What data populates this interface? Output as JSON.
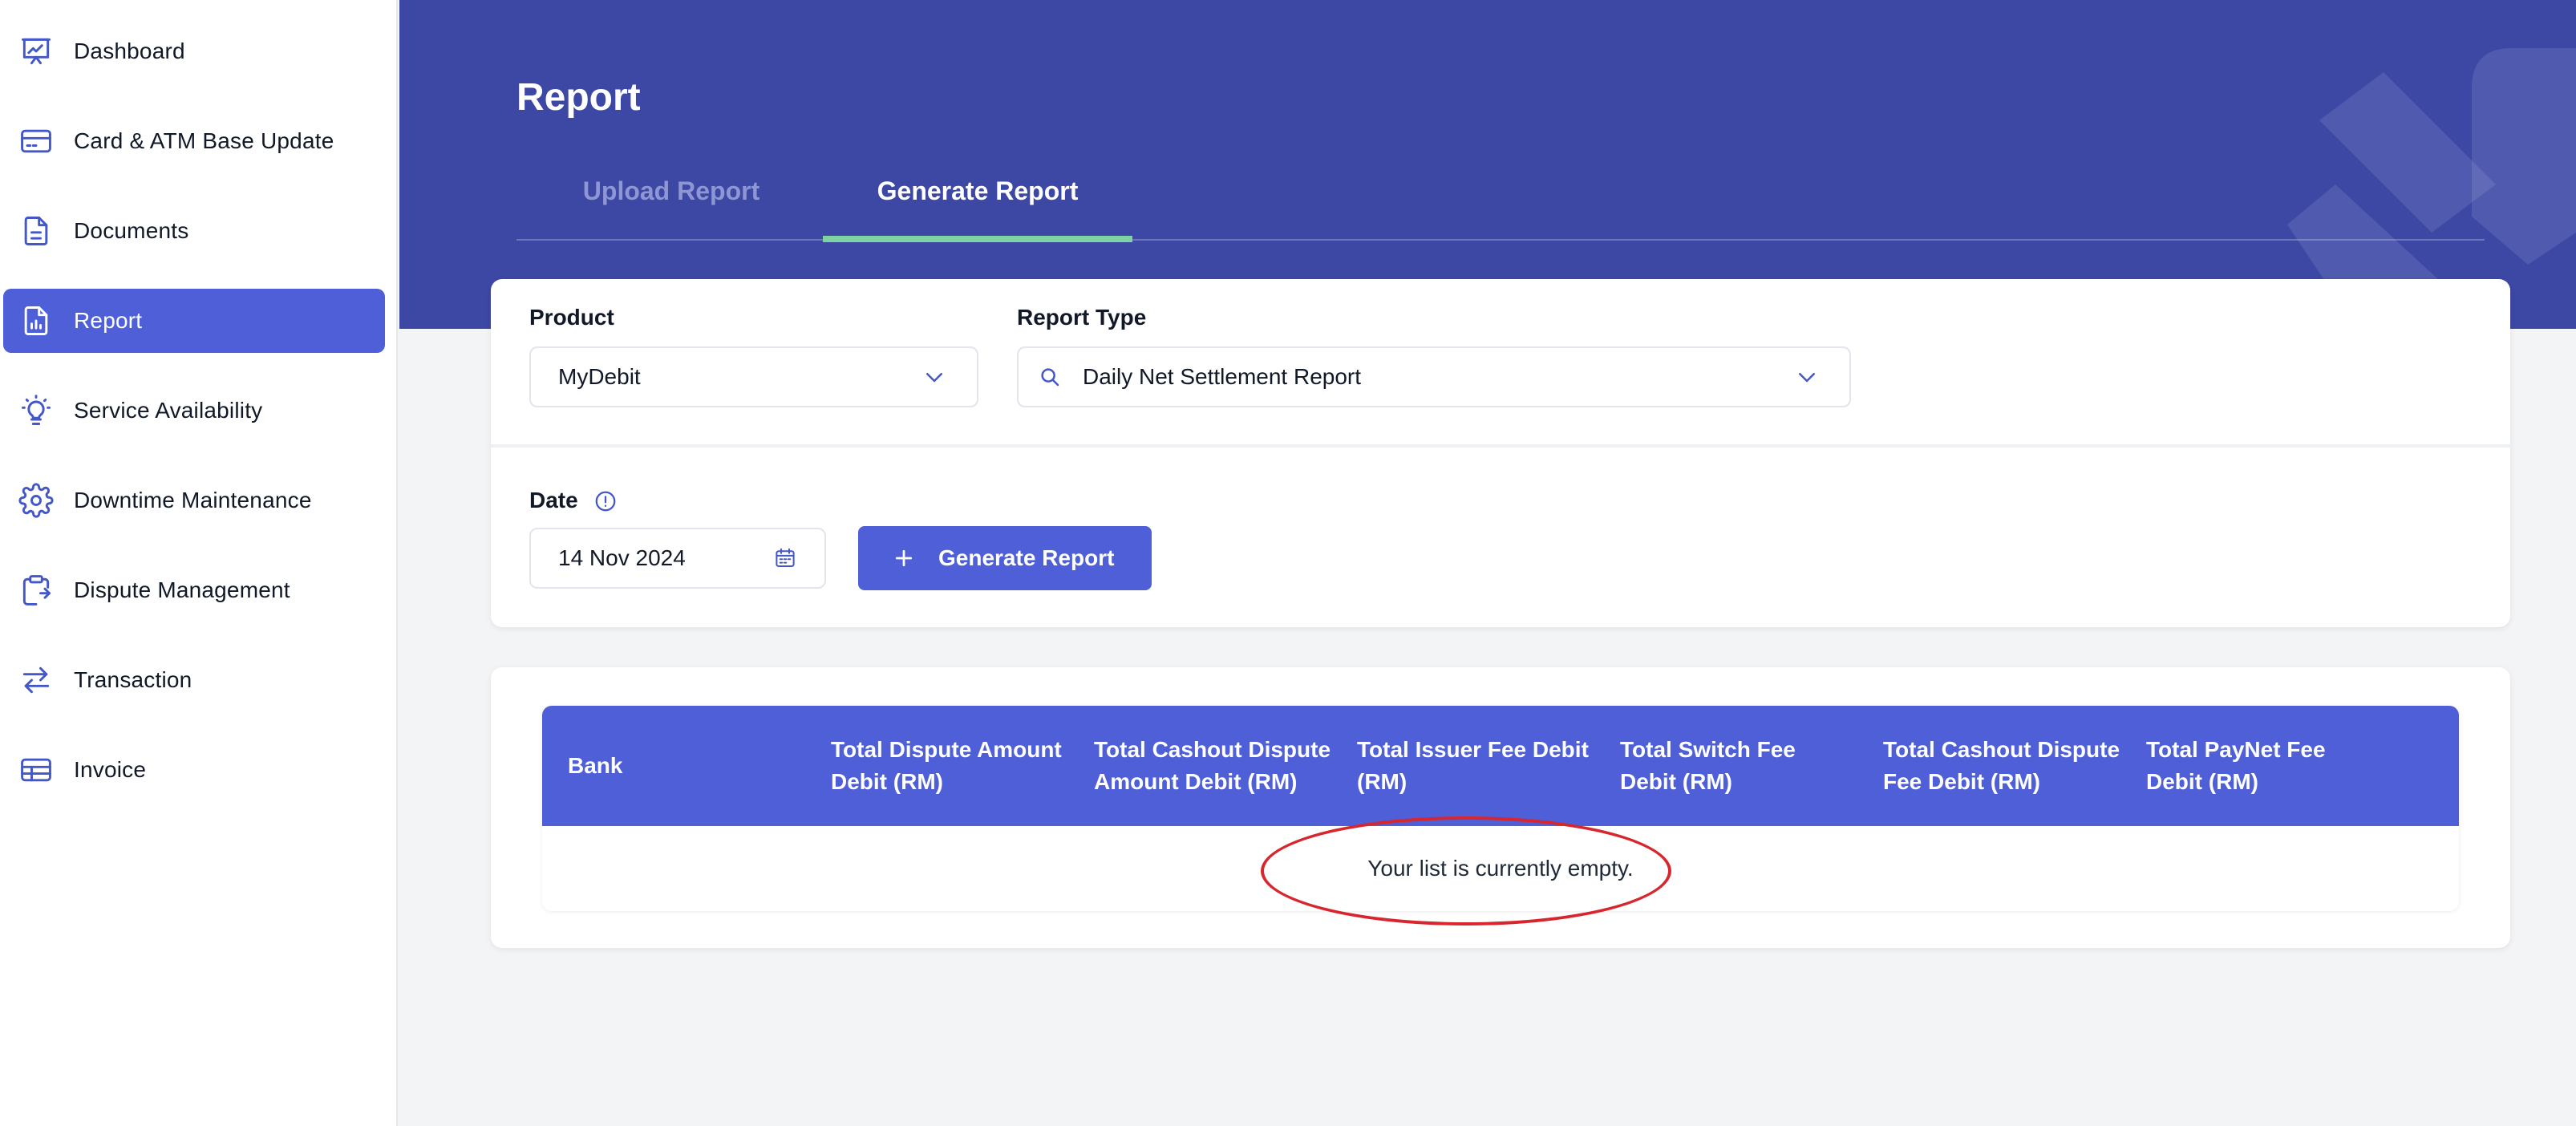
{
  "sidebar": {
    "items": [
      {
        "label": "Dashboard",
        "icon": "presentation-chart-icon",
        "active": false
      },
      {
        "label": "Card & ATM Base Update",
        "icon": "credit-card-icon",
        "active": false
      },
      {
        "label": "Documents",
        "icon": "document-icon",
        "active": false
      },
      {
        "label": "Report",
        "icon": "report-chart-icon",
        "active": true
      },
      {
        "label": "Service Availability",
        "icon": "lightbulb-icon",
        "active": false
      },
      {
        "label": "Downtime Maintenance",
        "icon": "gear-icon",
        "active": false
      },
      {
        "label": "Dispute Management",
        "icon": "clipboard-icon",
        "active": false
      },
      {
        "label": "Transaction",
        "icon": "arrows-exchange-icon",
        "active": false
      },
      {
        "label": "Invoice",
        "icon": "invoice-table-icon",
        "active": false
      }
    ]
  },
  "header": {
    "title": "Report",
    "tabs": [
      {
        "label": "Upload Report",
        "active": false
      },
      {
        "label": "Generate Report",
        "active": true
      }
    ]
  },
  "filters": {
    "product_label": "Product",
    "product_value": "MyDebit",
    "report_type_label": "Report Type",
    "report_type_value": "Daily Net Settlement Report",
    "date_label": "Date",
    "date_value": "14 Nov 2024",
    "generate_button": "Generate Report"
  },
  "table": {
    "columns": [
      "Bank",
      "Total Dispute Amount Debit (RM)",
      "Total Cashout Dispute Amount Debit (RM)",
      "Total Issuer Fee Debit (RM)",
      "Total Switch Fee Debit (RM)",
      "Total Cashout Dispute Fee Debit (RM)",
      "Total PayNet Fee Debit (RM)"
    ],
    "rows": [],
    "empty_message": "Your list is currently empty."
  },
  "colors": {
    "primary": "#4e5fd8",
    "header_bg": "#3d48a5",
    "tab_underline": "#7ed3a0",
    "annotation": "#d7262d"
  }
}
